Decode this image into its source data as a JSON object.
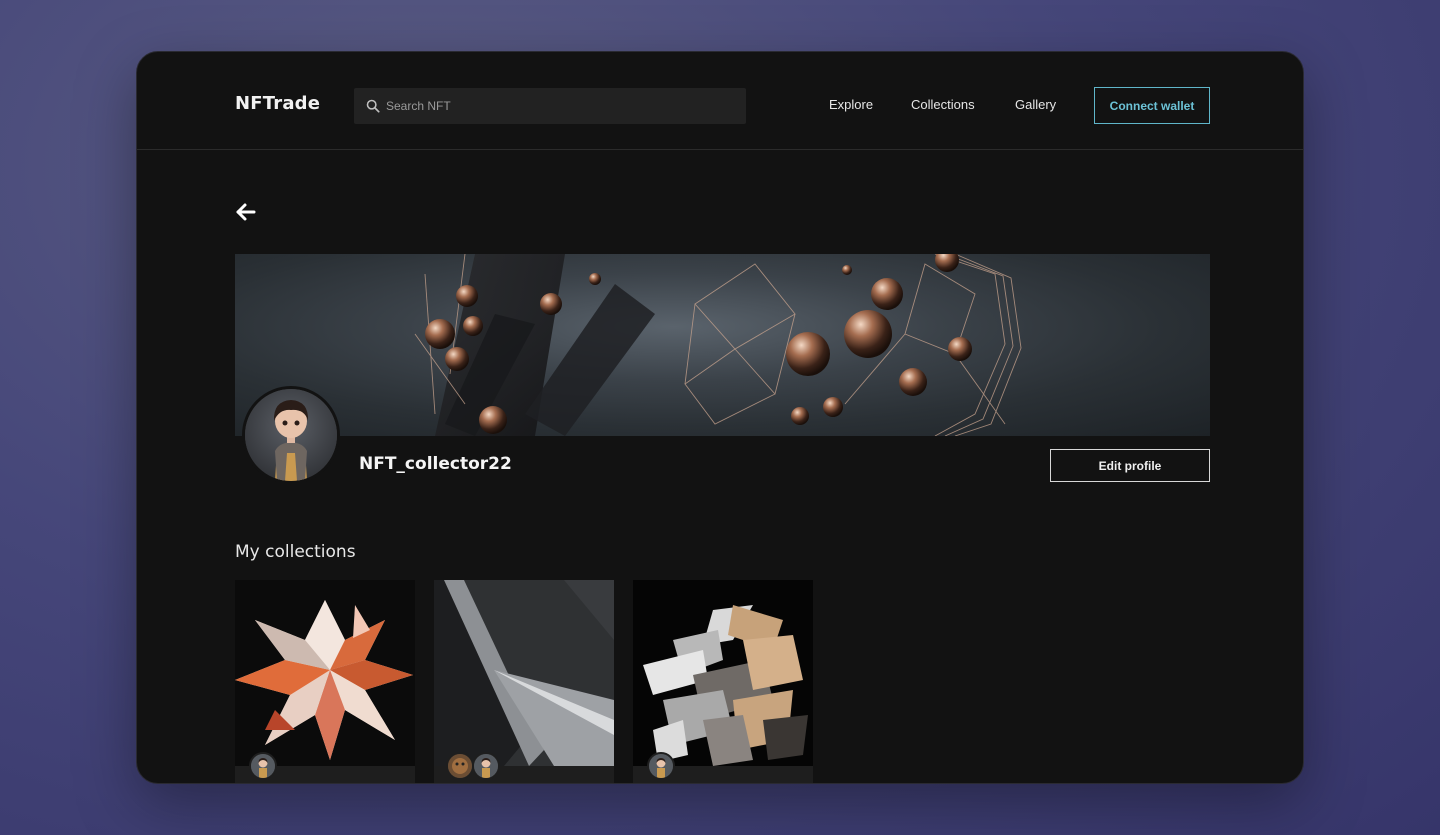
{
  "nav": {
    "logo": "NFTrade",
    "search_placeholder": "Search NFT",
    "links": [
      "Explore",
      "Collections",
      "Gallery"
    ],
    "connect_label": "Connect wallet"
  },
  "profile": {
    "username": "NFT_collector22",
    "edit_label": "Edit profile"
  },
  "collections": {
    "title": "My collections",
    "items": [
      {
        "art": "crystal-flower",
        "owners": [
          "avatar-character"
        ]
      },
      {
        "art": "grey-abstract",
        "owners": [
          "avatar-bear",
          "avatar-character"
        ]
      },
      {
        "art": "metallic-shapes",
        "owners": [
          "avatar-character"
        ]
      }
    ]
  },
  "colors": {
    "accent": "#6cc2d6",
    "background": "#121212",
    "surface": "#222222"
  }
}
